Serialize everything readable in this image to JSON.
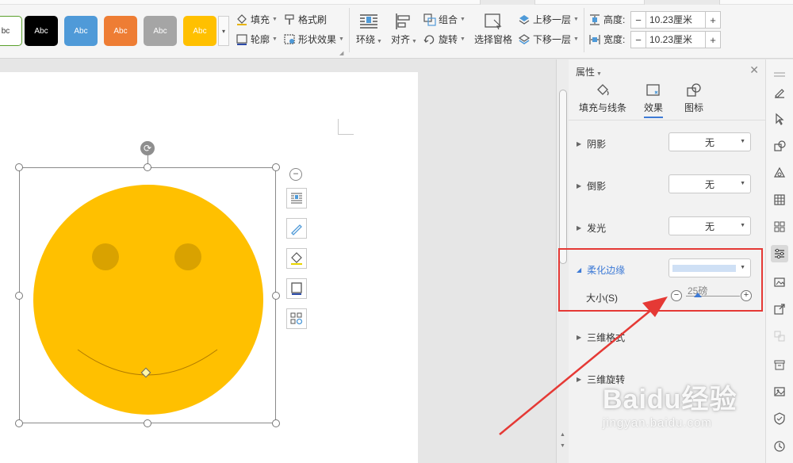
{
  "ribbon": {
    "style_gallery": [
      {
        "label": "bc",
        "bg": "#ffffff",
        "fg": "#333333",
        "border": "#5aa02c"
      },
      {
        "label": "Abc",
        "bg": "#000000",
        "fg": "#ffffff",
        "border": "#000000"
      },
      {
        "label": "Abc",
        "bg": "#4f9ad8",
        "fg": "#ffffff",
        "border": "#4f9ad8"
      },
      {
        "label": "Abc",
        "bg": "#ee7d34",
        "fg": "#ffffff",
        "border": "#ee7d34"
      },
      {
        "label": "Abc",
        "bg": "#a5a5a5",
        "fg": "#ffffff",
        "border": "#a5a5a5"
      },
      {
        "label": "Abc",
        "bg": "#ffc000",
        "fg": "#ffffff",
        "border": "#ffc000"
      }
    ],
    "fill": "填充",
    "format_painter": "格式刷",
    "outline": "轮廓",
    "shape_effects": "形状效果",
    "wrap": "环绕",
    "align": "对齐",
    "group": "组合",
    "rotate": "旋转",
    "selection_pane": "选择窗格",
    "bring_forward": "上移一层",
    "send_backward": "下移一层",
    "height_label": "高度:",
    "height_value": "10.23厘米",
    "width_label": "宽度:",
    "width_value": "10.23厘米"
  },
  "panel": {
    "title": "属性",
    "tabs": [
      "填充与线条",
      "效果",
      "图标"
    ],
    "active_tab": "效果",
    "sections": {
      "shadow": {
        "label": "阴影",
        "value": "无"
      },
      "reflection": {
        "label": "倒影",
        "value": "无"
      },
      "glow": {
        "label": "发光",
        "value": "无"
      },
      "soft_edges": {
        "label": "柔化边缘",
        "size_label": "大小(S)",
        "size_value": "25磅"
      },
      "format_3d": "三维格式",
      "rotation_3d": "三维旋转"
    }
  },
  "watermark": {
    "main": "Baidu经验",
    "sub": "jingyan.baidu.com"
  },
  "colors": {
    "accent": "#3d7ad6",
    "highlight": "#e53935",
    "smiley": "#ffc000"
  }
}
